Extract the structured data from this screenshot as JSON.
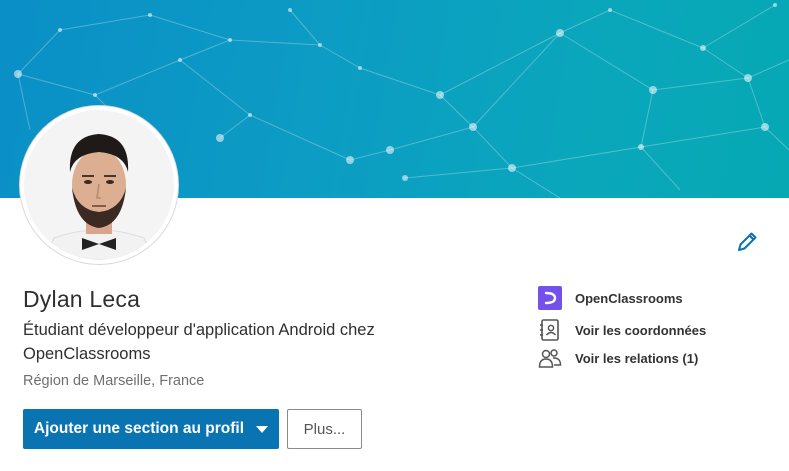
{
  "profile": {
    "name": "Dylan Leca",
    "headline": "Étudiant développeur d'application Android chez OpenClassrooms",
    "location": "Région de Marseille, France"
  },
  "actions": {
    "add_section_label": "Ajouter une section au profil",
    "more_label": "Plus..."
  },
  "sidebar": {
    "items": [
      {
        "label": "OpenClassrooms",
        "icon": "company-logo-icon"
      },
      {
        "label": "Voir les coordonnées",
        "icon": "contact-card-icon"
      },
      {
        "label": "Voir les relations (1)",
        "icon": "people-icon"
      }
    ]
  },
  "icons": {
    "edit": "pencil-icon"
  },
  "colors": {
    "primary": "#0a73b1",
    "banner": "#0a9cc4",
    "company_logo": "#7451eb",
    "edit_icon": "#0a73b1"
  }
}
